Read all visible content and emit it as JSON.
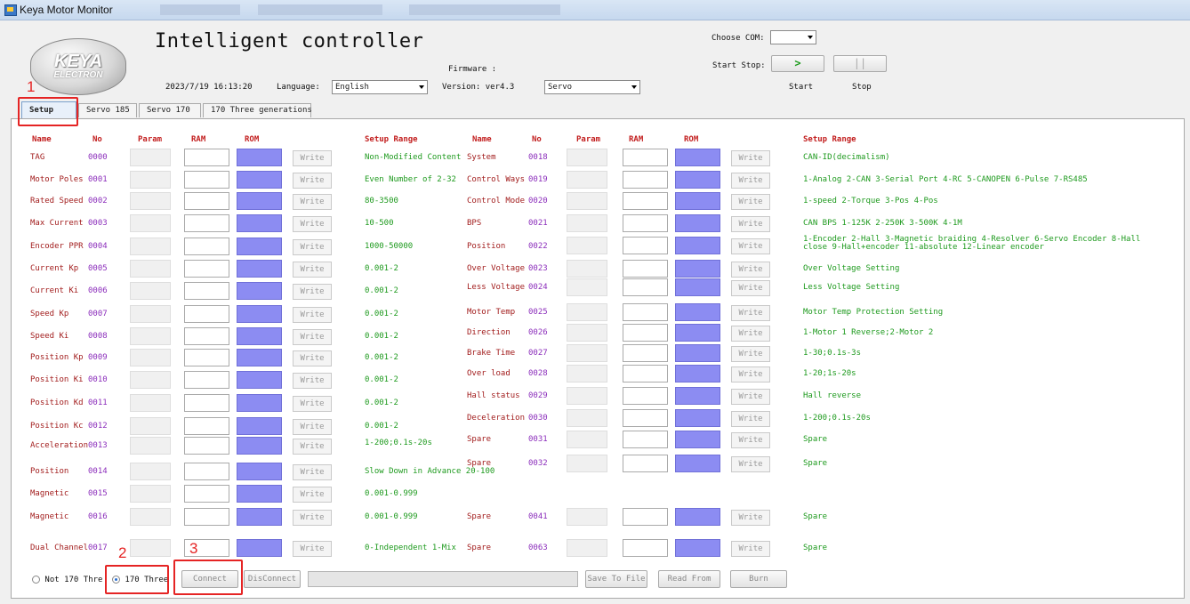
{
  "window": {
    "title": "Keya Motor Monitor"
  },
  "header": {
    "logo_line1": "KEYA",
    "logo_line2": "ELECTRON",
    "app_title": "Intelligent controller",
    "datetime": "2023/7/19 16:13:20",
    "language_label": "Language:",
    "language_value": "English",
    "firmware_label": "Firmware :",
    "version_label": "Version: ver4.3",
    "mode_value": "Servo",
    "choose_com_label": "Choose COM:",
    "com_value": "",
    "start_stop_label": "Start Stop:",
    "start_icon": ">",
    "stop_icon": "||",
    "start_label": "Start",
    "stop_label": "Stop"
  },
  "tabs": [
    "Setup",
    "Servo 185",
    "Servo 170",
    "170 Three generations"
  ],
  "headers": {
    "name": "Name",
    "no": "No",
    "param": "Param",
    "ram": "RAM",
    "rom": "ROM",
    "range": "Setup Range"
  },
  "write_label": "Write",
  "left_rows": [
    {
      "name": "TAG",
      "no": "0000",
      "range": "Non-Modified Content"
    },
    {
      "name": "Motor Poles",
      "no": "0001",
      "range": "Even Number of 2-32"
    },
    {
      "name": "Rated Speed",
      "no": "0002",
      "range": "80-3500"
    },
    {
      "name": "Max Current",
      "no": "0003",
      "range": "10-500"
    },
    {
      "name": "Encoder PPR",
      "no": "0004",
      "range": "1000-50000"
    },
    {
      "name": "Current Kp",
      "no": "0005",
      "range": "0.001-2"
    },
    {
      "name": "Current Ki",
      "no": "0006",
      "range": "0.001-2"
    },
    {
      "name": "Speed Kp",
      "no": "0007",
      "range": "0.001-2"
    },
    {
      "name": "Speed Ki",
      "no": "0008",
      "range": "0.001-2"
    },
    {
      "name": "Position Kp",
      "no": "0009",
      "range": "0.001-2"
    },
    {
      "name": "Position Ki",
      "no": "0010",
      "range": "0.001-2"
    },
    {
      "name": "Position Kd",
      "no": "0011",
      "range": "0.001-2"
    },
    {
      "name": "Position Kc",
      "no": "0012",
      "range": "0.001-2"
    },
    {
      "name": "Acceleration",
      "no": "0013",
      "range": "1-200;0.1s-20s"
    },
    {
      "name": "Position",
      "no": "0014",
      "range": "Slow Down in Advance 20-100"
    },
    {
      "name": "Magnetic",
      "no": "0015",
      "range": "0.001-0.999"
    },
    {
      "name": "Magnetic",
      "no": "0016",
      "range": "0.001-0.999"
    },
    {
      "name": "Dual Channel",
      "no": "0017",
      "range": "0-Independent 1-Mix"
    }
  ],
  "right_rows": [
    {
      "name": "System",
      "no": "0018",
      "range": "CAN-ID(decimalism)"
    },
    {
      "name": "Control Ways",
      "no": "0019",
      "range": "1-Analog 2-CAN 3-Serial Port 4-RC 5-CANOPEN 6-Pulse 7-RS485"
    },
    {
      "name": "Control Mode",
      "no": "0020",
      "range": "1-speed 2-Torque 3-Pos 4-Pos"
    },
    {
      "name": "BPS",
      "no": "0021",
      "range": "CAN BPS 1-125K 2-250K 3-500K 4-1M"
    },
    {
      "name": "Position",
      "no": "0022",
      "range": "1-Encoder 2-Hall 3-Magnetic braiding 4-Resolver 6-Servo Encoder 8-Hall",
      "range2": "close 9-Hall+encoder  11-absolute 12-Linear encoder"
    },
    {
      "name": "Over Voltage",
      "no": "0023",
      "range": "Over Voltage Setting"
    },
    {
      "name": "Less Voltage",
      "no": "0024",
      "range": "Less Voltage Setting"
    },
    {
      "name": "Motor Temp",
      "no": "0025",
      "range": "Motor Temp Protection Setting"
    },
    {
      "name": "Direction",
      "no": "0026",
      "range": "1-Motor 1 Reverse;2-Motor 2"
    },
    {
      "name": "Brake Time",
      "no": "0027",
      "range": "1-30;0.1s-3s"
    },
    {
      "name": "Over load",
      "no": "0028",
      "range": "1-20;1s-20s"
    },
    {
      "name": "Hall status",
      "no": "0029",
      "range": "Hall reverse"
    },
    {
      "name": "Deceleration",
      "no": "0030",
      "range": "1-200;0.1s-20s"
    },
    {
      "name": "Spare",
      "no": "0031",
      "range": "Spare"
    },
    {
      "name": "Spare",
      "no": "0032",
      "range": "Spare"
    },
    {
      "name": "Spare",
      "no": "0041",
      "range": "Spare"
    },
    {
      "name": "Spare",
      "no": "0063",
      "range": "Spare"
    }
  ],
  "footer": {
    "radio_not170": "Not 170 Thre",
    "radio_170": "170 Three",
    "connect": "Connect",
    "disconnect": "DisConnect",
    "save_to_file": "Save To File",
    "read_from": "Read From",
    "burn": "Burn"
  },
  "annotations": [
    "1",
    "2",
    "3"
  ]
}
